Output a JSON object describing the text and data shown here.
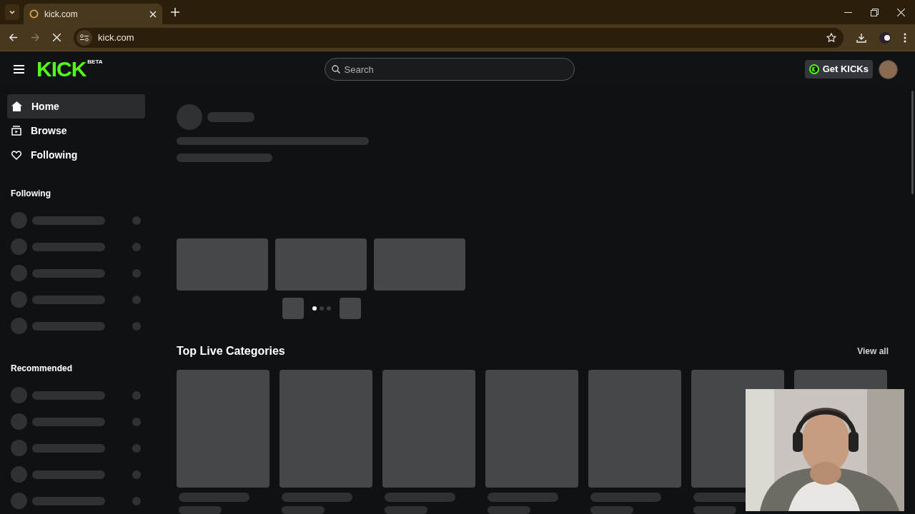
{
  "browser": {
    "tab_title": "kick.com",
    "url": "kick.com"
  },
  "header": {
    "logo": "KICK",
    "logo_badge": "BETA",
    "search": {
      "placeholder": "Search"
    },
    "get_kicks": "Get KICKs"
  },
  "sidebar": {
    "items": [
      {
        "kind": "home",
        "label": "Home",
        "selected": true
      },
      {
        "kind": "browse",
        "label": "Browse",
        "selected": false
      },
      {
        "kind": "following",
        "label": "Following",
        "selected": false
      }
    ],
    "following_title": "Following",
    "recommended_title": "Recommended"
  },
  "carousel": {
    "dots": [
      {
        "selected": true
      },
      {
        "selected": false
      },
      {
        "selected": false
      }
    ]
  },
  "categories": {
    "title": "Top Live Categories",
    "view_all": "View all"
  }
}
